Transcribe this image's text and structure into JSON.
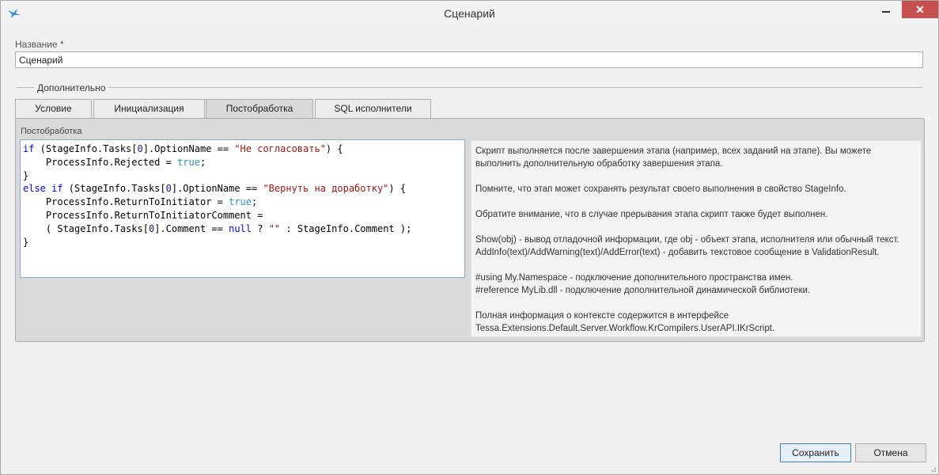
{
  "window": {
    "title": "Сценарий",
    "close_glyph": "✕"
  },
  "name_field": {
    "label": "Название  *",
    "value": "Сценарий"
  },
  "section": {
    "title": "Дополнительно"
  },
  "tabs": [
    {
      "label": "Условие"
    },
    {
      "label": "Инициализация"
    },
    {
      "label": "Постобработка"
    },
    {
      "label": "SQL исполнители"
    }
  ],
  "active_tab": "Постобработка",
  "panel": {
    "label": "Постобработка"
  },
  "code_lines": [
    [
      [
        "kw",
        "if"
      ],
      [
        "t",
        " (StageInfo.Tasks["
      ],
      [
        "num",
        "0"
      ],
      [
        "t",
        "].OptionName == "
      ],
      [
        "str",
        "\"Не согласовать\""
      ],
      [
        "t",
        ") {"
      ]
    ],
    [
      [
        "t",
        "    ProcessInfo.Rejected = "
      ],
      [
        "typ",
        "true"
      ],
      [
        "t",
        ";"
      ]
    ],
    [
      [
        "t",
        "}"
      ]
    ],
    [
      [
        "kw",
        "else if"
      ],
      [
        "t",
        " (StageInfo.Tasks["
      ],
      [
        "num",
        "0"
      ],
      [
        "t",
        "].OptionName == "
      ],
      [
        "str",
        "\"Вернуть на доработку\""
      ],
      [
        "t",
        ") {"
      ]
    ],
    [
      [
        "t",
        "    ProcessInfo.ReturnToInitiator = "
      ],
      [
        "typ",
        "true"
      ],
      [
        "t",
        ";"
      ]
    ],
    [
      [
        "t",
        "    ProcessInfo.ReturnToInitiatorComment ="
      ]
    ],
    [
      [
        "t",
        "    ( StageInfo.Tasks["
      ],
      [
        "num",
        "0"
      ],
      [
        "t",
        "].Comment == "
      ],
      [
        "kw",
        "null"
      ],
      [
        "t",
        " ? "
      ],
      [
        "str",
        "\"\""
      ],
      [
        "t",
        " : StageInfo.Comment );"
      ]
    ],
    [
      [
        "t",
        "}"
      ]
    ]
  ],
  "help_lines": [
    "Скрипт выполняется после завершения этапа (например, всех заданий на этапе). Вы можете",
    "выполнить дополнительную обработку завершения этапа.",
    "",
    "Помните, что этап может сохранять результат своего выполнения в свойство StageInfo.",
    "",
    "Обратите внимание, что в случае прерывания этапа скрипт также будет выполнен.",
    "",
    "Show(obj) - вывод отладочной информации, где obj - объект этапа, исполнителя или обычный текст.",
    "AddInfo(text)/AddWarning(text)/AddError(text) - добавить текстовое сообщение в ValidationResult.",
    "",
    "#using My.Namespace - подключение дополнительного пространства имен.",
    "#reference MyLib.dll - подключение дополнительной динамической библиотеки.",
    "",
    "Полная информация о контексте содержится в интерфейсе",
    "Tessa.Extensions.Default.Server.Workflow.KrCompilers.UserAPI.IKrScript."
  ],
  "buttons": {
    "save": "Сохранить",
    "cancel": "Отмена"
  },
  "colors": {
    "close_button": "#c75050",
    "keyword": "#0000ff",
    "string": "#a31515",
    "editor_border": "#8aa8d6"
  },
  "icons": {
    "app": "tessa-logo-icon",
    "minimize": "minimize-icon",
    "close": "close-icon"
  }
}
